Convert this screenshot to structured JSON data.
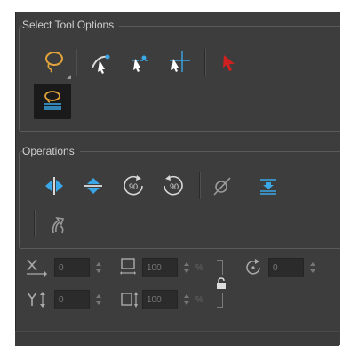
{
  "select_tool_options": {
    "title": "Select Tool Options",
    "tools": [
      {
        "name": "lasso-icon",
        "selected": false
      },
      {
        "name": "snap-to-contour-icon",
        "selected": false
      },
      {
        "name": "snap-and-align-icon",
        "selected": false
      },
      {
        "name": "no-snap-icon",
        "selected": false
      },
      {
        "name": "select-by-color-arrow-icon",
        "selected": false
      },
      {
        "name": "apply-to-line-and-colour-icon",
        "selected": true
      }
    ]
  },
  "operations": {
    "title": "Operations",
    "buttons": [
      {
        "name": "flip-horizontal-icon"
      },
      {
        "name": "flip-vertical-icon"
      },
      {
        "name": "rotate-90-cw-icon",
        "label": "90"
      },
      {
        "name": "rotate-90-ccw-icon",
        "label": "90"
      },
      {
        "name": "create-empty-drawing-icon"
      },
      {
        "name": "flatten-icon"
      },
      {
        "name": "convert-to-brush-icon"
      }
    ]
  },
  "transform_fields": {
    "x_value": "0",
    "y_value": "0",
    "width_value": "100",
    "height_value": "100",
    "angle_value": "0",
    "percent_unit": "%"
  },
  "colors": {
    "panel_bg": "#3d3d3d",
    "accent_blue": "#3aa7e8",
    "accent_orange": "#e0a23a",
    "accent_red": "#d02020"
  }
}
